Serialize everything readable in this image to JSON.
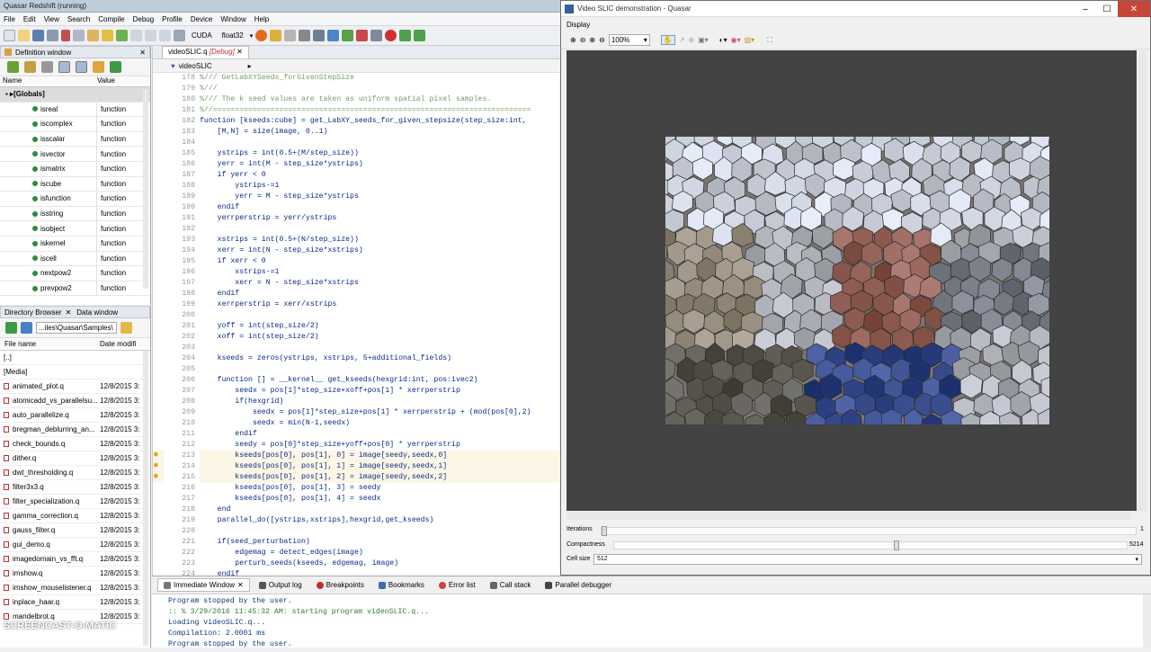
{
  "main_title": "Quasar Redshift (running)",
  "menu": [
    "File",
    "Edit",
    "View",
    "Search",
    "Compile",
    "Debug",
    "Profile",
    "Device",
    "Window",
    "Help"
  ],
  "toolbar": {
    "device": "CUDA",
    "precision": "float32"
  },
  "definition_window": {
    "title": "Definition window",
    "col_name": "Name",
    "col_value": "Value",
    "group": "[Globals]",
    "items": [
      [
        "isreal",
        "function"
      ],
      [
        "iscomplex",
        "function"
      ],
      [
        "isscalar",
        "function"
      ],
      [
        "isvector",
        "function"
      ],
      [
        "ismatrix",
        "function"
      ],
      [
        "iscube",
        "function"
      ],
      [
        "isfunction",
        "function"
      ],
      [
        "isstring",
        "function"
      ],
      [
        "isobject",
        "function"
      ],
      [
        "iskernel",
        "function"
      ],
      [
        "iscell",
        "function"
      ],
      [
        "nextpow2",
        "function"
      ],
      [
        "prevpow2",
        "function"
      ]
    ]
  },
  "directory": {
    "tab1": "Directory Browser",
    "tab2": "Data window",
    "path": "...iles\\Quasar\\Samples\\",
    "col_name": "File name",
    "col_date": "Date modifi",
    "files": [
      [
        "[..]",
        ""
      ],
      [
        "[Media]",
        ""
      ],
      [
        "animated_plot.q",
        "12/8/2015 3:"
      ],
      [
        "atomicadd_vs_parallelsu...",
        "12/8/2015 3:"
      ],
      [
        "auto_parallelize.q",
        "12/8/2015 3:"
      ],
      [
        "bregman_deblurring_an...",
        "12/8/2015 3:"
      ],
      [
        "check_bounds.q",
        "12/8/2015 3:"
      ],
      [
        "dither.q",
        "12/8/2015 3:"
      ],
      [
        "dwt_thresholding.q",
        "12/8/2015 3:"
      ],
      [
        "filter3x3.q",
        "12/8/2015 3:"
      ],
      [
        "filter_specialization.q",
        "12/8/2015 3:"
      ],
      [
        "gamma_correction.q",
        "12/8/2015 3:"
      ],
      [
        "gauss_filter.q",
        "12/8/2015 3:"
      ],
      [
        "gui_demo.q",
        "12/8/2015 3:"
      ],
      [
        "imagedomain_vs_fft.q",
        "12/8/2015 3:"
      ],
      [
        "imshow.q",
        "12/8/2015 3:"
      ],
      [
        "imshow_mouselistener.q",
        "12/8/2015 3:"
      ],
      [
        "inplace_haar.q",
        "12/8/2015 3:"
      ],
      [
        "mandelbrot.q",
        "12/8/2015 3:"
      ]
    ]
  },
  "editor": {
    "tab": "videoSLIC.q",
    "tab_state": "[Debug]",
    "nav": "videoSLIC",
    "lines": [
      [
        "178",
        "%/// GetLabXYSeeds_forGivenStepSize"
      ],
      [
        "179",
        "%///"
      ],
      [
        "180",
        "%/// The k seed values are taken as uniform spatial pixel samples."
      ],
      [
        "181",
        "%//========================================================================"
      ],
      [
        "182",
        "function [kseeds:cube] = get_LabXY_seeds_for_given_stepsize(step_size:int,"
      ],
      [
        "183",
        "    [M,N] = size(image, 0..1)"
      ],
      [
        "184",
        ""
      ],
      [
        "185",
        "    ystrips = int(0.5+(M/step_size))"
      ],
      [
        "186",
        "    yerr = int(M - step_size*ystrips)"
      ],
      [
        "187",
        "    if yerr < 0"
      ],
      [
        "188",
        "        ystrips-=1"
      ],
      [
        "189",
        "        yerr = M - step_size*ystrips"
      ],
      [
        "190",
        "    endif"
      ],
      [
        "191",
        "    yerrperstrip = yerr/ystrips"
      ],
      [
        "192",
        ""
      ],
      [
        "193",
        "    xstrips = int(0.5+(N/step_size))"
      ],
      [
        "194",
        "    xerr = int(N - step_size*xstrips)"
      ],
      [
        "195",
        "    if xerr < 0"
      ],
      [
        "196",
        "        xstrips-=1"
      ],
      [
        "197",
        "        xerr = N - step_size*xstrips"
      ],
      [
        "198",
        "    endif"
      ],
      [
        "199",
        "    xerrperstrip = xerr/xstrips"
      ],
      [
        "200",
        ""
      ],
      [
        "201",
        "    yoff = int(step_size/2)"
      ],
      [
        "202",
        "    xoff = int(step_size/2)"
      ],
      [
        "203",
        ""
      ],
      [
        "204",
        "    kseeds = zeros(ystrips, xstrips, 5+additional_fields)"
      ],
      [
        "205",
        ""
      ],
      [
        "206",
        "    function [] = __kernel__ get_kseeds(hexgrid:int, pos:ivec2)"
      ],
      [
        "207",
        "        seedx = pos[1]*step_size+xoff+pos[1] * xerrperstrip"
      ],
      [
        "208",
        "        if(hexgrid)"
      ],
      [
        "209",
        "            seedx = pos[1]*step_size+pos[1] * xerrperstrip + (mod(pos[0],2)"
      ],
      [
        "210",
        "            seedx = min(N-1,seedx)"
      ],
      [
        "211",
        "        endif"
      ],
      [
        "212",
        "        seedy = pos[0]*step_size+yoff+pos[0] * yerrperstrip"
      ],
      [
        "213",
        "        kseeds[pos[0], pos[1], 0] = image[seedy,seedx,0]"
      ],
      [
        "214",
        "        kseeds[pos[0], pos[1], 1] = image[seedy,seedx,1]"
      ],
      [
        "215",
        "        kseeds[pos[0], pos[1], 2] = image[seedy,seedx,2]"
      ],
      [
        "216",
        "        kseeds[pos[0], pos[1], 3] = seedy"
      ],
      [
        "217",
        "        kseeds[pos[0], pos[1], 4] = seedx"
      ],
      [
        "218",
        "    end"
      ],
      [
        "219",
        "    parallel_do([ystrips,xstrips],hexgrid,get_kseeds)"
      ],
      [
        "220",
        ""
      ],
      [
        "221",
        "    if(seed_perturbation)"
      ],
      [
        "222",
        "        edgemag = detect_edges(image)"
      ],
      [
        "223",
        "        perturb_seeds(kseeds, edgemag, image)"
      ],
      [
        "224",
        "    endif"
      ]
    ]
  },
  "bottom": {
    "tabs": [
      "Immediate Window",
      "Output log",
      "Breakpoints",
      "Bookmarks",
      "Error list",
      "Call stack",
      "Parallel debugger"
    ],
    "output": [
      "Program stopped by the user.",
      ":: % 3/29/2016 11:45:32 AM: starting program videoSLIC.q...",
      "Loading videoSLIC.q...",
      "Compilation: 2.0001 ms",
      "Program stopped by the user."
    ]
  },
  "video_window": {
    "title": "Video SLIC demonstration - Quasar",
    "display_label": "Display",
    "zoom": "100%",
    "iterations_label": "Iterations",
    "iterations_value": "1",
    "compactness_label": "Compactness",
    "compactness_value": "5214",
    "compactness_level": 0.545,
    "cellsize_label": "Cell size",
    "cellsize_value": "512"
  },
  "watermark": "SCREENCAST-O-MATIC"
}
